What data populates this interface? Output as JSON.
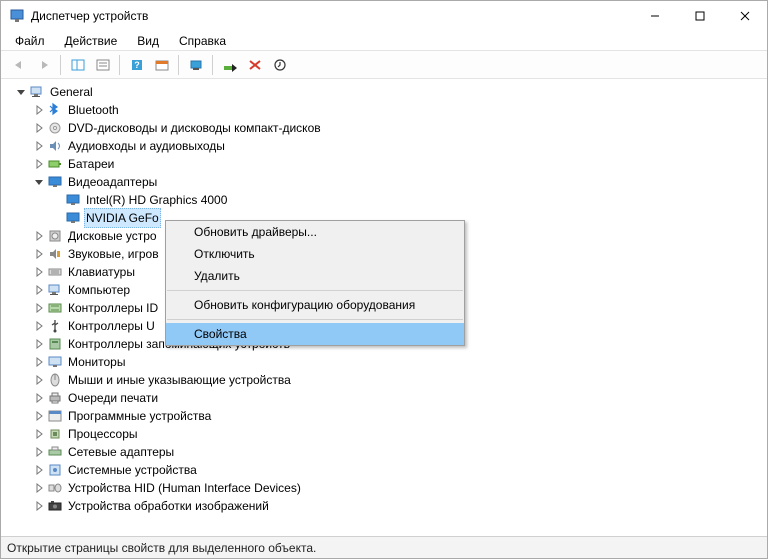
{
  "title": "Диспетчер устройств",
  "menus": {
    "file": "Файл",
    "action": "Действие",
    "view": "Вид",
    "help": "Справка"
  },
  "statusbar": "Открытие страницы свойств для выделенного объекта.",
  "tree": {
    "root": "General",
    "items": [
      {
        "label": "Bluetooth",
        "icon": "bluetooth"
      },
      {
        "label": "DVD-дисководы и дисководы компакт-дисков",
        "icon": "dvd"
      },
      {
        "label": "Аудиовходы и аудиовыходы",
        "icon": "audio"
      },
      {
        "label": "Батареи",
        "icon": "battery"
      },
      {
        "label": "Видеоадаптеры",
        "icon": "display",
        "expanded": true,
        "children": [
          {
            "label": "Intel(R) HD Graphics 4000",
            "icon": "display"
          },
          {
            "label": "NVIDIA GeFo",
            "icon": "display",
            "selected": true
          }
        ]
      },
      {
        "label": "Дисковые устро",
        "icon": "disk"
      },
      {
        "label": "Звуковые, игров",
        "icon": "sound"
      },
      {
        "label": "Клавиатуры",
        "icon": "keyboard"
      },
      {
        "label": "Компьютер",
        "icon": "computer"
      },
      {
        "label": "Контроллеры ID",
        "icon": "ide"
      },
      {
        "label": "Контроллеры U",
        "icon": "usb"
      },
      {
        "label": "Контроллеры запоминающих устройств",
        "icon": "storage"
      },
      {
        "label": "Мониторы",
        "icon": "monitor"
      },
      {
        "label": "Мыши и иные указывающие устройства",
        "icon": "mouse"
      },
      {
        "label": "Очереди печати",
        "icon": "printer"
      },
      {
        "label": "Программные устройства",
        "icon": "software"
      },
      {
        "label": "Процессоры",
        "icon": "cpu"
      },
      {
        "label": "Сетевые адаптеры",
        "icon": "network"
      },
      {
        "label": "Системные устройства",
        "icon": "system"
      },
      {
        "label": "Устройства HID (Human Interface Devices)",
        "icon": "hid"
      },
      {
        "label": "Устройства обработки изображений",
        "icon": "imaging"
      }
    ]
  },
  "context_menu": {
    "update": "Обновить драйверы...",
    "disable": "Отключить",
    "uninstall": "Удалить",
    "scan": "Обновить конфигурацию оборудования",
    "properties": "Свойства"
  }
}
